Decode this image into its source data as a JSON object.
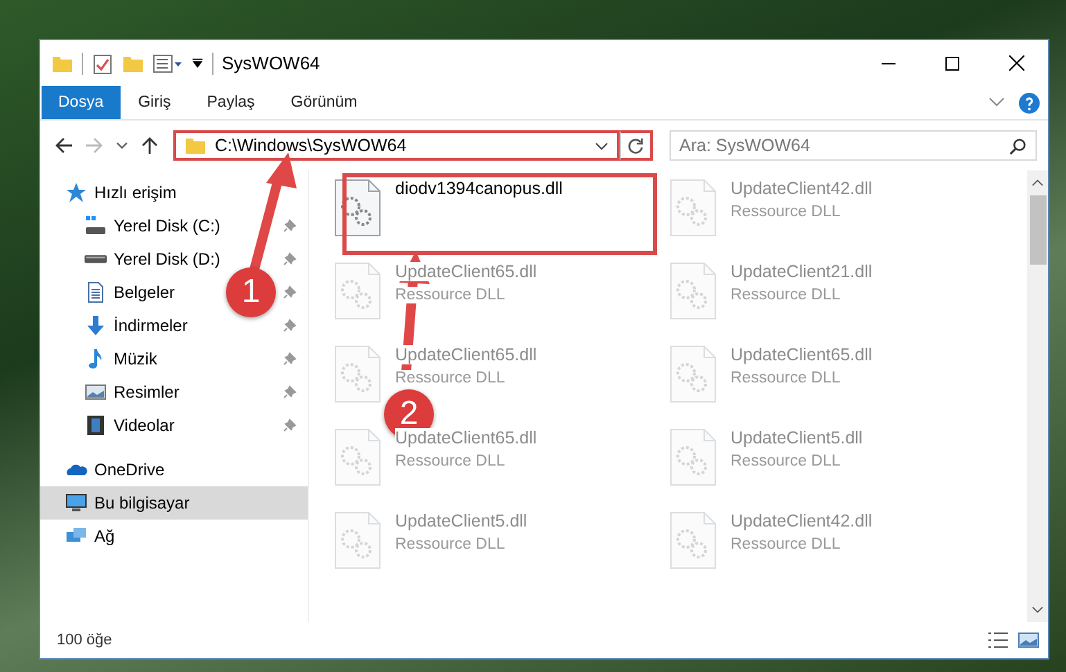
{
  "window": {
    "title": "SysWOW64"
  },
  "ribbon_tabs": [
    {
      "label": "Dosya",
      "selected": true
    },
    {
      "label": "Giriş",
      "selected": false
    },
    {
      "label": "Paylaş",
      "selected": false
    },
    {
      "label": "Görünüm",
      "selected": false
    }
  ],
  "address_bar": {
    "path": "C:\\Windows\\SysWOW64"
  },
  "search": {
    "placeholder": "Ara: SysWOW64"
  },
  "sidebar": {
    "items": [
      {
        "label": "Hızlı erişim",
        "kind": "star",
        "selected": false,
        "children": [
          {
            "label": "Yerel Disk (C:)",
            "kind": "drive-c",
            "pinned": true
          },
          {
            "label": "Yerel Disk (D:)",
            "kind": "drive",
            "pinned": true
          },
          {
            "label": "Belgeler",
            "kind": "document",
            "pinned": true
          },
          {
            "label": "İndirmeler",
            "kind": "download",
            "pinned": true
          },
          {
            "label": "Müzik",
            "kind": "music",
            "pinned": true
          },
          {
            "label": "Resimler",
            "kind": "pictures",
            "pinned": true
          },
          {
            "label": "Videolar",
            "kind": "video",
            "pinned": true
          }
        ]
      },
      {
        "label": "OneDrive",
        "kind": "cloud",
        "selected": false
      },
      {
        "label": "Bu bilgisayar",
        "kind": "computer",
        "selected": true
      },
      {
        "label": "Ağ",
        "kind": "network",
        "selected": false
      }
    ]
  },
  "files": [
    {
      "name": "diodv1394canopus.dll",
      "kind": "focus"
    },
    {
      "name": "UpdateClient42.dll",
      "type": "Ressource DLL",
      "kind": "faded"
    },
    {
      "name": "UpdateClient65.dll",
      "type": "Ressource DLL",
      "kind": "faded"
    },
    {
      "name": "UpdateClient21.dll",
      "type": "Ressource DLL",
      "kind": "faded"
    },
    {
      "name": "UpdateClient65.dll",
      "type": "Ressource DLL",
      "kind": "faded"
    },
    {
      "name": "UpdateClient65.dll",
      "type": "Ressource DLL",
      "kind": "faded"
    },
    {
      "name": "UpdateClient65.dll",
      "type": "Ressource DLL",
      "kind": "faded"
    },
    {
      "name": "UpdateClient5.dll",
      "type": "Ressource DLL",
      "kind": "faded"
    },
    {
      "name": "UpdateClient5.dll",
      "type": "Ressource DLL",
      "kind": "faded"
    },
    {
      "name": "UpdateClient42.dll",
      "type": "Ressource DLL",
      "kind": "faded"
    }
  ],
  "status_bar": {
    "count": "100 öğe"
  },
  "annotations": [
    {
      "number": "1"
    },
    {
      "number": "2"
    }
  ]
}
